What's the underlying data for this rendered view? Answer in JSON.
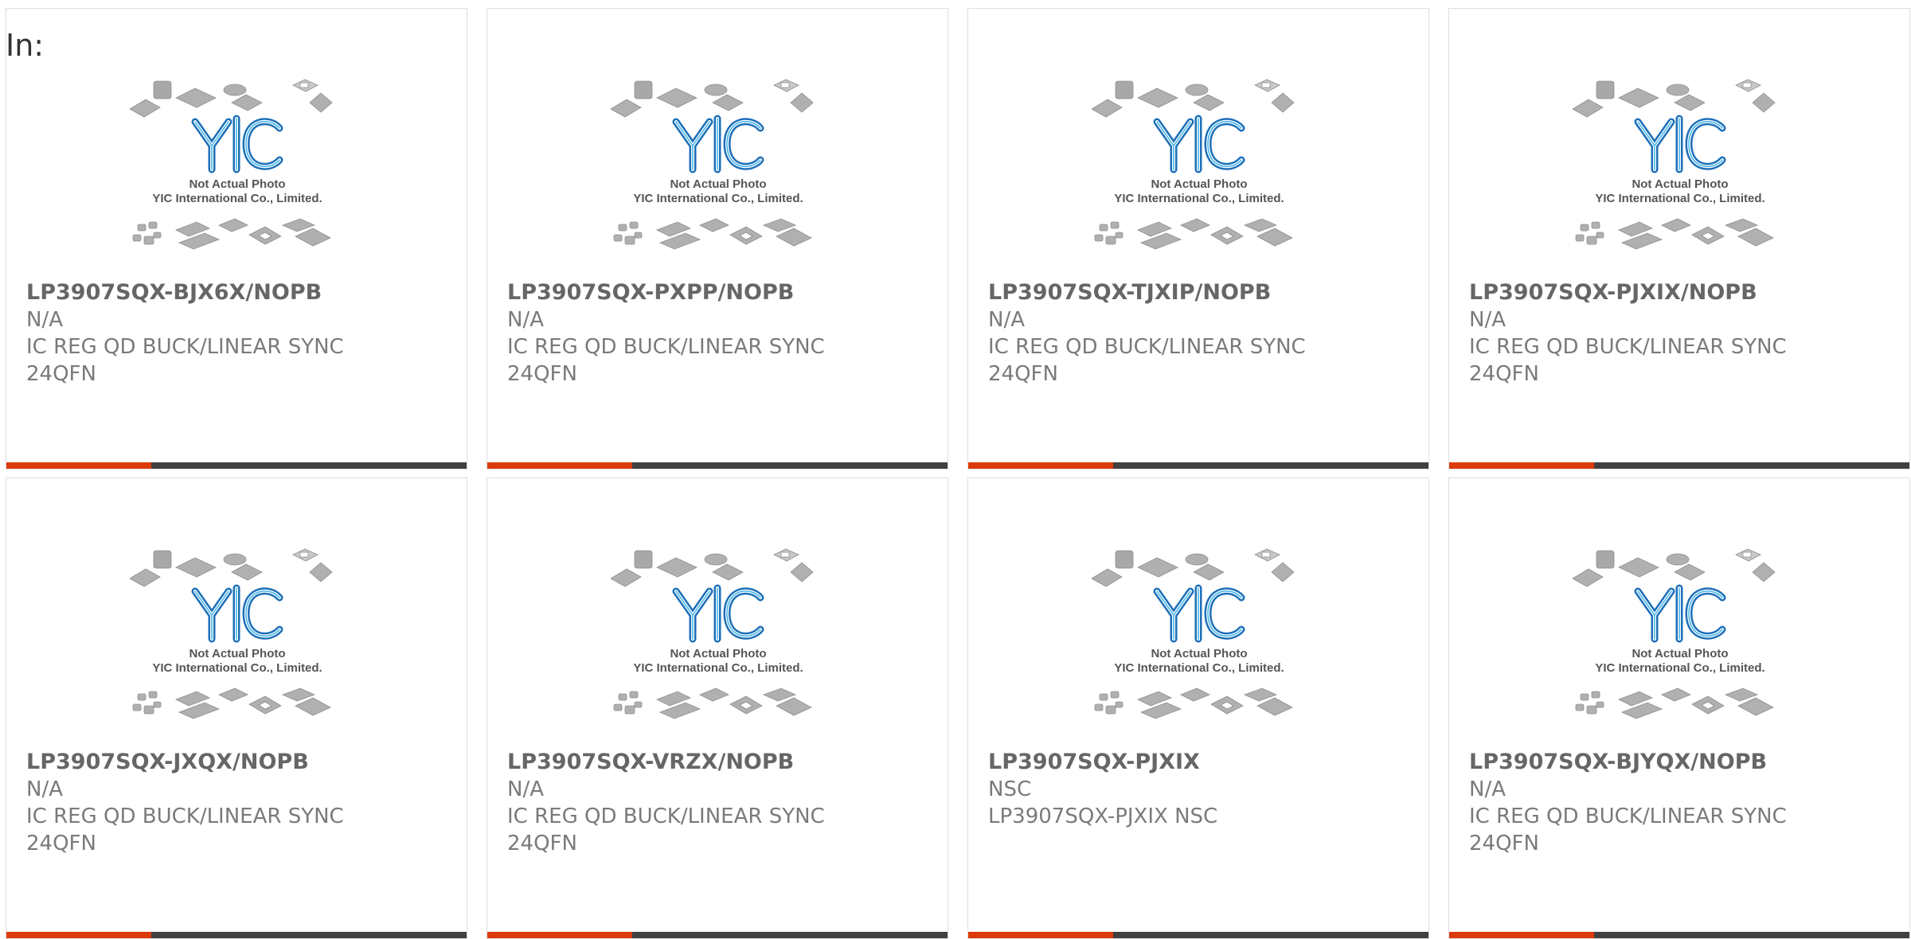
{
  "prefix_label": "In:",
  "placeholder": {
    "line1": "Not Actual Photo",
    "line2": "YIC International Co., Limited.",
    "logo_text": "YIC",
    "logo_color": "#1d6fb8"
  },
  "colors": {
    "accent": "#dd3a0b",
    "bar": "#404040",
    "text": "#7a7a7a",
    "border": "#dedede"
  },
  "products": [
    {
      "part": "LP3907SQX-BJX6X/NOPB",
      "mfr": "N/A",
      "desc": "IC REG QD BUCK/LINEAR SYNC 24QFN"
    },
    {
      "part": "LP3907SQX-PXPP/NOPB",
      "mfr": "N/A",
      "desc": "IC REG QD BUCK/LINEAR SYNC 24QFN"
    },
    {
      "part": "LP3907SQX-TJXIP/NOPB",
      "mfr": "N/A",
      "desc": "IC REG QD BUCK/LINEAR SYNC 24QFN"
    },
    {
      "part": "LP3907SQX-PJXIX/NOPB",
      "mfr": "N/A",
      "desc": "IC REG QD BUCK/LINEAR SYNC 24QFN"
    },
    {
      "part": "LP3907SQX-JXQX/NOPB",
      "mfr": "N/A",
      "desc": "IC REG QD BUCK/LINEAR SYNC 24QFN"
    },
    {
      "part": "LP3907SQX-VRZX/NOPB",
      "mfr": "N/A",
      "desc": "IC REG QD BUCK/LINEAR SYNC 24QFN"
    },
    {
      "part": "LP3907SQX-PJXIX",
      "mfr": "NSC",
      "desc": "LP3907SQX-PJXIX NSC"
    },
    {
      "part": "LP3907SQX-BJYQX/NOPB",
      "mfr": "N/A",
      "desc": "IC REG QD BUCK/LINEAR SYNC 24QFN"
    }
  ]
}
